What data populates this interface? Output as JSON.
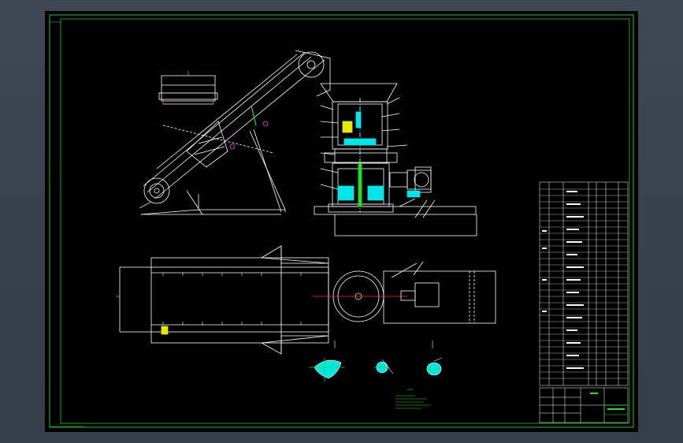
{
  "drawing": {
    "background": "#000000",
    "border_color": "#22c02a",
    "line_color": "#ffffff",
    "accent_cyan": "#00e5e5",
    "accent_green": "#22e022",
    "accent_red": "#ff3030",
    "accent_yellow": "#e8e800",
    "accent_magenta": "#ff40ff"
  },
  "views": {
    "front": "front-elevation",
    "top": "plan-view",
    "sections": [
      "section-a",
      "section-b",
      "section-c"
    ]
  },
  "title_block": {
    "rows": 30,
    "columns": 6
  }
}
